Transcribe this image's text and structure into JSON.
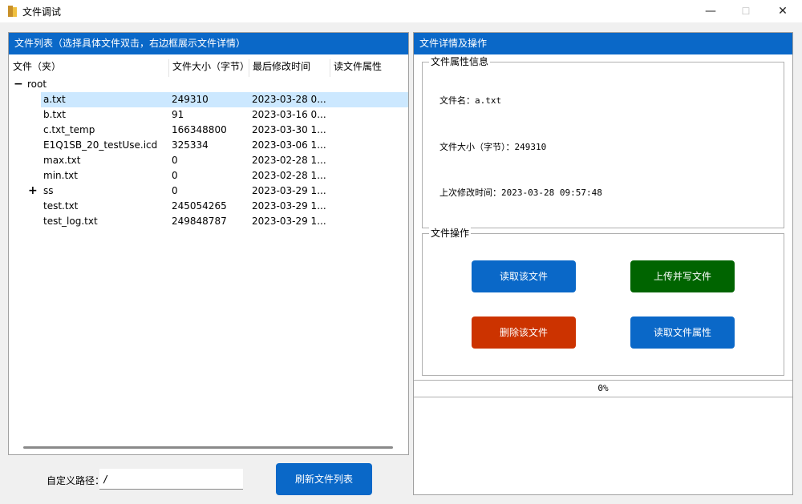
{
  "window": {
    "title": "文件调试",
    "minimize": "—",
    "maximize": "☐",
    "close": "✕"
  },
  "left_panel": {
    "header": "文件列表（选择具体文件双击，右边框展示文件详情）",
    "columns": [
      "文件（夹）",
      "文件大小（字节）",
      "最后修改时间",
      "读文件属性"
    ],
    "root": {
      "expander": "−",
      "name": "root"
    },
    "rows": [
      {
        "expander": "",
        "name": "a.txt",
        "size": "249310",
        "time": "2023-03-28 0...",
        "selected": true
      },
      {
        "expander": "",
        "name": "b.txt",
        "size": "91",
        "time": "2023-03-16 0...",
        "selected": false
      },
      {
        "expander": "",
        "name": "c.txt_temp",
        "size": "166348800",
        "time": "2023-03-30 1...",
        "selected": false
      },
      {
        "expander": "",
        "name": "E1Q1SB_20_testUse.icd",
        "size": "325334",
        "time": "2023-03-06 1...",
        "selected": false
      },
      {
        "expander": "",
        "name": "max.txt",
        "size": "0",
        "time": "2023-02-28 1...",
        "selected": false
      },
      {
        "expander": "",
        "name": "min.txt",
        "size": "0",
        "time": "2023-02-28 1...",
        "selected": false
      },
      {
        "expander": "+",
        "name": "ss",
        "size": "0",
        "time": "2023-03-29 1...",
        "selected": false
      },
      {
        "expander": "",
        "name": "test.txt",
        "size": "245054265",
        "time": "2023-03-29 1...",
        "selected": false
      },
      {
        "expander": "",
        "name": "test_log.txt",
        "size": "249848787",
        "time": "2023-03-29 1...",
        "selected": false
      }
    ],
    "path_label": "自定义路径：",
    "path_value": "/",
    "refresh_button": "刷新文件列表"
  },
  "right_panel": {
    "header": "文件详情及操作",
    "info_group": {
      "title": "文件属性信息",
      "name_line": "文件名：a.txt",
      "size_line": "文件大小（字节）：249310",
      "time_line": "上次修改时间：2023-03-28 09:57:48"
    },
    "ops_group": {
      "title": "文件操作",
      "read_button": "读取该文件",
      "upload_button": "上传并写文件",
      "delete_button": "删除该文件",
      "attr_button": "读取文件属性"
    },
    "progress": {
      "value": 0,
      "text": "0%"
    }
  },
  "colors": {
    "header_blue": "#0a68c8",
    "button_blue": "#0a68c8",
    "button_green": "#006400",
    "button_red": "#cc3300",
    "selection": "#cce8ff"
  }
}
